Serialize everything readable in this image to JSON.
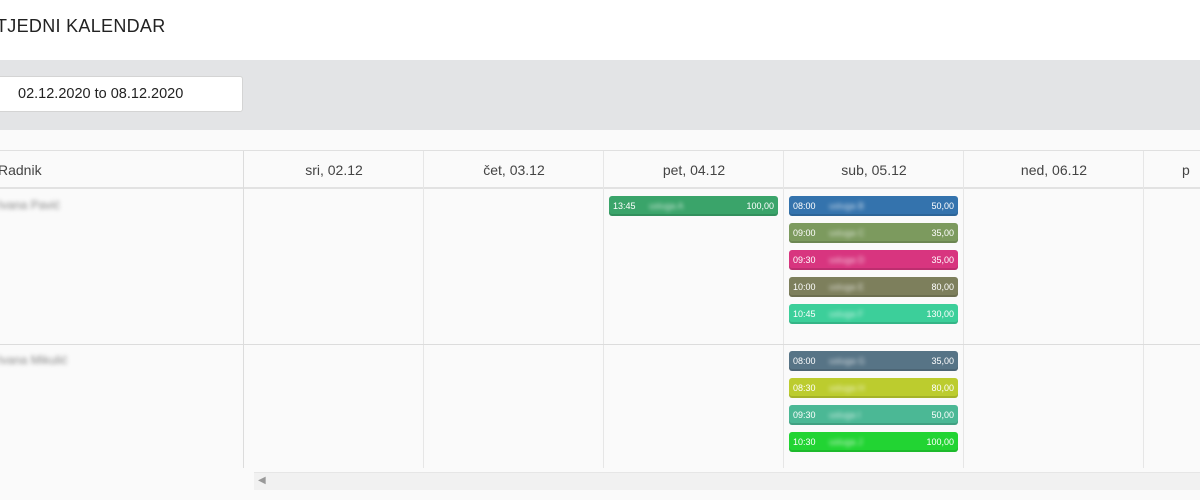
{
  "page": {
    "title": "TJEDNI KALENDAR"
  },
  "toolbar": {
    "date_range": "02.12.2020 to 08.12.2020"
  },
  "table": {
    "worker_header": "Radnik",
    "days": [
      "sri, 02.12",
      "čet, 03.12",
      "pet, 04.12",
      "sub, 05.12",
      "ned, 06.12",
      "p"
    ],
    "workers": [
      {
        "name": "Ivana Pavić"
      },
      {
        "name": "Ivana Mikulić"
      }
    ]
  },
  "events": [
    {
      "worker": 0,
      "day": 2,
      "slot": 0,
      "time": "13:45",
      "desc": "usluga A",
      "amount": "100,00",
      "color": "#3aa46a"
    },
    {
      "worker": 0,
      "day": 3,
      "slot": 0,
      "time": "08:00",
      "desc": "usluga B",
      "amount": "50,00",
      "color": "#3473ad"
    },
    {
      "worker": 0,
      "day": 3,
      "slot": 1,
      "time": "09:00",
      "desc": "usluga C",
      "amount": "35,00",
      "color": "#7c9a5e"
    },
    {
      "worker": 0,
      "day": 3,
      "slot": 2,
      "time": "09:30",
      "desc": "usluga D",
      "amount": "35,00",
      "color": "#d8357f"
    },
    {
      "worker": 0,
      "day": 3,
      "slot": 3,
      "time": "10:00",
      "desc": "usluga E",
      "amount": "80,00",
      "color": "#7d7f5c"
    },
    {
      "worker": 0,
      "day": 3,
      "slot": 4,
      "time": "10:45",
      "desc": "usluga F",
      "amount": "130,00",
      "color": "#3ccf9a"
    },
    {
      "worker": 1,
      "day": 3,
      "slot": 0,
      "time": "08:00",
      "desc": "usluga G",
      "amount": "35,00",
      "color": "#577486"
    },
    {
      "worker": 1,
      "day": 3,
      "slot": 1,
      "time": "08:30",
      "desc": "usluga H",
      "amount": "80,00",
      "color": "#bccc2e"
    },
    {
      "worker": 1,
      "day": 3,
      "slot": 2,
      "time": "09:30",
      "desc": "usluga I",
      "amount": "50,00",
      "color": "#4bb895"
    },
    {
      "worker": 1,
      "day": 3,
      "slot": 3,
      "time": "10:30",
      "desc": "usluga J",
      "amount": "100,00",
      "color": "#22d433"
    }
  ]
}
